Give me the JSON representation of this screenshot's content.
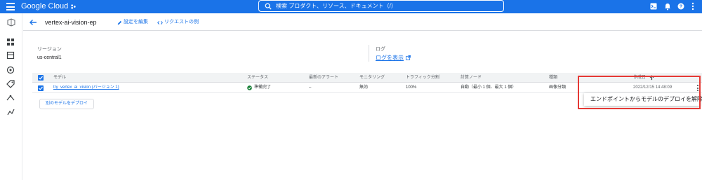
{
  "topbar": {
    "brand": "Google Cloud",
    "search_text": "検索 プロダクト、リソース、ドキュメント（/）",
    "icons": [
      "menu-icon",
      "project-icon",
      "search-icon",
      "cloud-shell-icon",
      "notifications-icon",
      "help-icon",
      "more-vert-icon"
    ],
    "bg_color": "#1a73e8"
  },
  "left_rail": {
    "icons": [
      "vertex-ai-logo-icon",
      "dashboard-icon",
      "datasets-icon",
      "workbench-icon",
      "labeling-icon",
      "pipelines-icon",
      "experiments-icon"
    ]
  },
  "subheader": {
    "title": "vertex-ai-vision-ep",
    "edit_label": "設定を編集",
    "request_label": "リクエストの例"
  },
  "info": {
    "region_label": "リージョン",
    "region_value": "us-central1",
    "log_label": "ログ",
    "log_link": "ログを表示"
  },
  "table": {
    "headers": {
      "model": "モデル",
      "status": "ステータス",
      "alert": "最新のアラート",
      "monitoring": "モニタリング",
      "traffic": "トラフィック分割",
      "compute": "計算ノード",
      "type": "種類",
      "created": "作成日"
    },
    "rows": [
      {
        "model": "try_vertex_ai_vision (バージョン 1)",
        "status": "準備完了",
        "alert": "–",
        "monitoring": "無効",
        "traffic": "100%",
        "compute": "自動（最小 1 個、最大 1 個）",
        "type": "画像分類",
        "created": "2022/12/15 14:48:09"
      }
    ]
  },
  "deploy_button": "別のモデルをデプロイ",
  "menu": {
    "item": "エンドポイントからモデルのデプロイを解除"
  },
  "colors": {
    "accent": "#1a73e8",
    "success": "#188038",
    "highlight": "#e53935"
  }
}
